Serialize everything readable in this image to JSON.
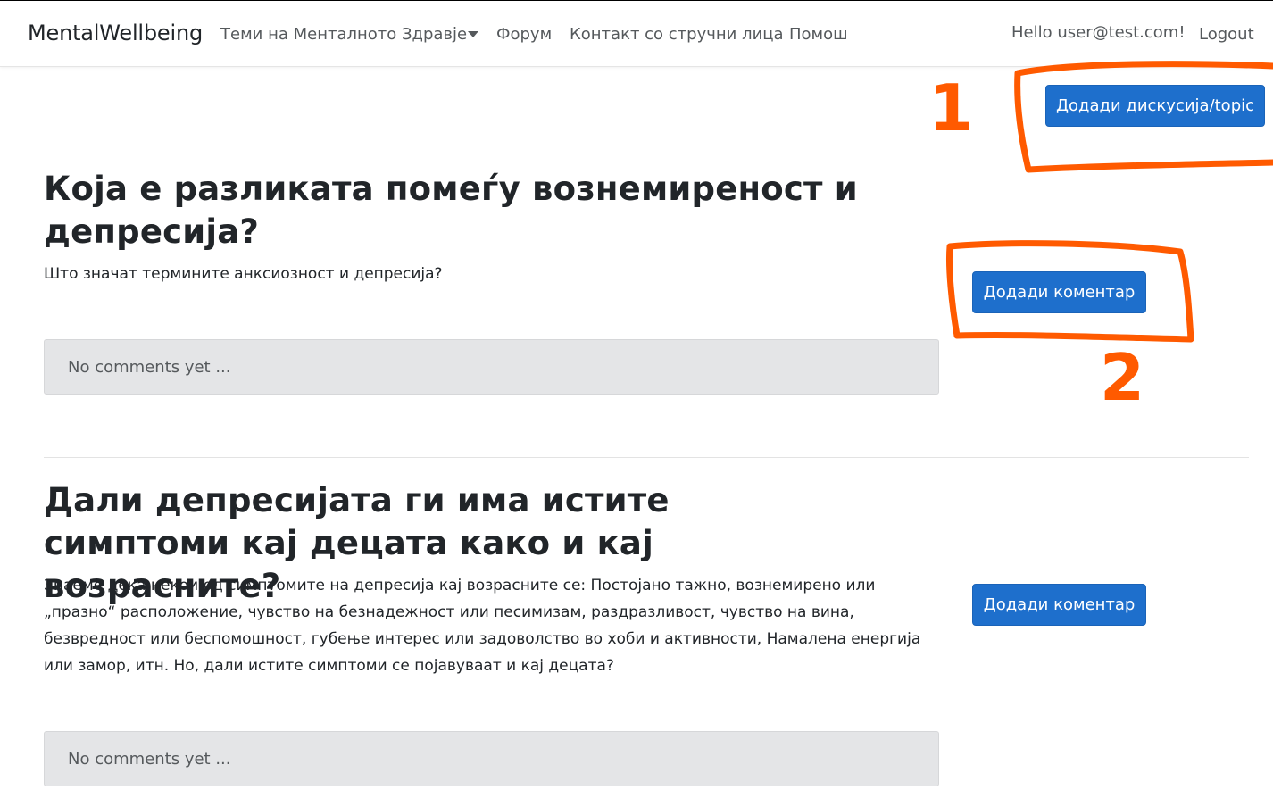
{
  "navbar": {
    "brand": "MentalWellbeing",
    "links": {
      "topics": "Теми на Менталното Здравје",
      "forum": "Форум",
      "contact": "Контакт со стручни лица",
      "help": "Помош"
    },
    "greeting": "Hello user@test.com!",
    "logout": "Logout"
  },
  "add_topic_button": "Додади дискусија/topic",
  "topics": [
    {
      "title": "Која е разликата помеѓу вознемиреност и депресија?",
      "body": "Што значат термините анксиозност и депресија?",
      "add_comment": "Додади коментар",
      "comments_placeholder": "No comments yet ..."
    },
    {
      "title": "Дали депресијата ги има истите симптоми кај децата како и кај возрасните?",
      "body": "Знаеме дека некои од симптомите на депресија кај возрасните се: Постојано тажно, вознемирено или „празно“ расположение, чувство на безнадежност или песимизам, раздразливост, чувство на вина, безвредност или беспомошност, губење интерес или задоволство во хоби и активности, Намалена енергија или замор, итн. Но, дали истите симптоми се појавуваат и кај децата?",
      "add_comment": "Додади коментар",
      "comments_placeholder": "No comments yet ..."
    }
  ],
  "annotations": {
    "color": "#ff5a00",
    "marker_1": "1",
    "marker_2": "2"
  }
}
